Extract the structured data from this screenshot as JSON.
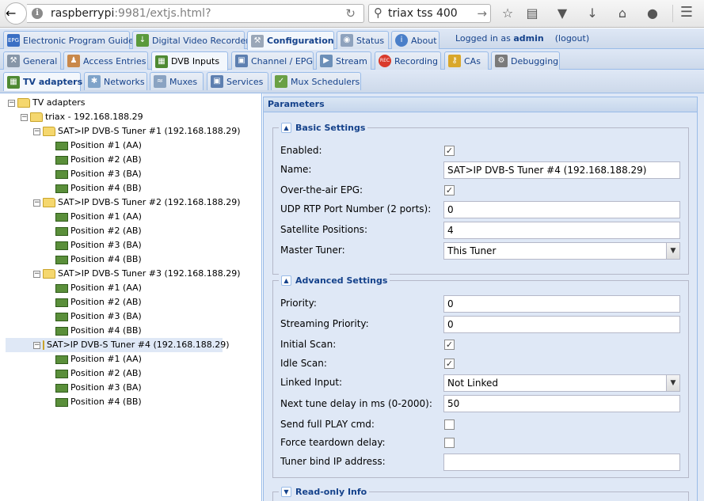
{
  "browser": {
    "url_host": "raspberrypi",
    "url_rest": ":9981/extjs.html?",
    "search_value": "triax tss 400",
    "info_icon": "i"
  },
  "top_tabs": [
    {
      "label": "Electronic Program Guide",
      "icon": "epg-icon"
    },
    {
      "label": "Digital Video Recorder",
      "icon": "dvr-icon"
    },
    {
      "label": "Configuration",
      "icon": "wrench-icon"
    },
    {
      "label": "Status",
      "icon": "eye-icon"
    },
    {
      "label": "About",
      "icon": "info-icon"
    }
  ],
  "login": {
    "prefix": "Logged in as",
    "user": "admin",
    "logout": "(logout)"
  },
  "config_tabs": [
    {
      "label": "General",
      "icon": "tools-icon"
    },
    {
      "label": "Access Entries",
      "icon": "users-icon"
    },
    {
      "label": "DVB Inputs",
      "icon": "dvb-card-icon"
    },
    {
      "label": "Channel / EPG",
      "icon": "tv-icon"
    },
    {
      "label": "Stream",
      "icon": "stream-icon"
    },
    {
      "label": "Recording",
      "icon": "rec-icon"
    },
    {
      "label": "CAs",
      "icon": "key-icon"
    },
    {
      "label": "Debugging",
      "icon": "bug-icon"
    }
  ],
  "dvb_tabs": [
    {
      "label": "TV adapters",
      "icon": "card-icon"
    },
    {
      "label": "Networks",
      "icon": "antenna-icon"
    },
    {
      "label": "Muxes",
      "icon": "mux-icon"
    },
    {
      "label": "Services",
      "icon": "tv-icon"
    },
    {
      "label": "Mux Schedulers",
      "icon": "scheduler-icon"
    }
  ],
  "tree": {
    "root": "TV adapters",
    "device": "triax - 192.168.188.29",
    "tuners": [
      {
        "label": "SAT>IP DVB-S Tuner #1 (192.168.188.29)",
        "positions": [
          "Position #1 (AA)",
          "Position #2 (AB)",
          "Position #3 (BA)",
          "Position #4 (BB)"
        ]
      },
      {
        "label": "SAT>IP DVB-S Tuner #2 (192.168.188.29)",
        "positions": [
          "Position #1 (AA)",
          "Position #2 (AB)",
          "Position #3 (BA)",
          "Position #4 (BB)"
        ]
      },
      {
        "label": "SAT>IP DVB-S Tuner #3 (192.168.188.29)",
        "positions": [
          "Position #1 (AA)",
          "Position #2 (AB)",
          "Position #3 (BA)",
          "Position #4 (BB)"
        ]
      },
      {
        "label": "SAT>IP DVB-S Tuner #4 (192.168.188.29)",
        "positions": [
          "Position #1 (AA)",
          "Position #2 (AB)",
          "Position #3 (BA)",
          "Position #4 (BB)"
        ]
      }
    ],
    "selected_tuner_index": 3
  },
  "params": {
    "title": "Parameters",
    "basic": {
      "legend": "Basic Settings",
      "enabled_label": "Enabled:",
      "enabled": true,
      "name_label": "Name:",
      "name_value": "SAT>IP DVB-S Tuner #4 (192.168.188.29)",
      "ota_epg_label": "Over-the-air EPG:",
      "ota_epg": true,
      "udp_label": "UDP RTP Port Number (2 ports):",
      "udp_value": "0",
      "sat_pos_label": "Satellite Positions:",
      "sat_pos_value": "4",
      "master_label": "Master Tuner:",
      "master_value": "This Tuner"
    },
    "advanced": {
      "legend": "Advanced Settings",
      "priority_label": "Priority:",
      "priority_value": "0",
      "streaming_priority_label": "Streaming Priority:",
      "streaming_priority_value": "0",
      "initial_scan_label": "Initial Scan:",
      "initial_scan": true,
      "idle_scan_label": "Idle Scan:",
      "idle_scan": true,
      "linked_input_label": "Linked Input:",
      "linked_input_value": "Not Linked",
      "next_tune_label": "Next tune delay in ms (0-2000):",
      "next_tune_value": "50",
      "full_play_label": "Send full PLAY cmd:",
      "full_play": false,
      "teardown_label": "Force teardown delay:",
      "teardown": false,
      "bind_ip_label": "Tuner bind IP address:",
      "bind_ip_value": ""
    },
    "readonly": {
      "legend": "Read-only Info"
    }
  },
  "colors": {
    "accent": "#15428b",
    "panel_bg": "#dfe8f6",
    "border": "#99bbe8"
  }
}
